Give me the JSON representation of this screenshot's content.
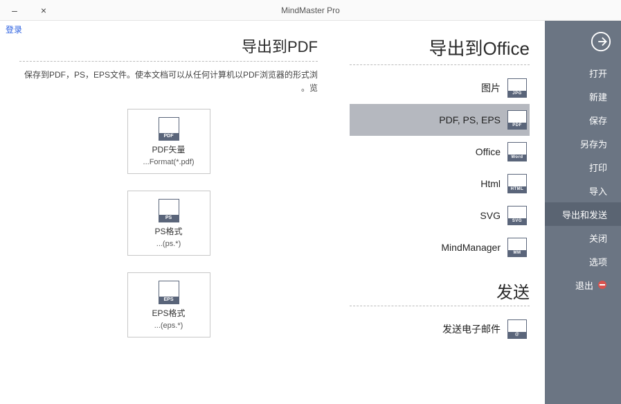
{
  "title": "MindMaster Pro",
  "login": "登录",
  "sidebar": {
    "items": [
      {
        "label": "打开"
      },
      {
        "label": "新建"
      },
      {
        "label": "保存"
      },
      {
        "label": "另存为"
      },
      {
        "label": "打印"
      },
      {
        "label": "导入"
      },
      {
        "label": "导出和发送",
        "selected": true
      },
      {
        "label": "关闭"
      },
      {
        "label": "选项"
      },
      {
        "label": "退出",
        "exit": true
      }
    ]
  },
  "middle": {
    "section1_title": "导出到Office",
    "categories": [
      {
        "tag": "JPG",
        "label": "图片"
      },
      {
        "tag": "PDF",
        "label": "PDF, PS, EPS",
        "selected": true
      },
      {
        "tag": "Word",
        "label": "Office"
      },
      {
        "tag": "HTML",
        "label": "Html"
      },
      {
        "tag": "SVG",
        "label": "SVG"
      },
      {
        "tag": "MM",
        "label": "MindManager"
      }
    ],
    "section2_title": "发送",
    "send_item": {
      "tag": "@",
      "label": "发送电子邮件"
    }
  },
  "detail": {
    "title": "导出到PDF",
    "desc": "保存到PDF，PS，EPS文件。使本文档可以从任何计算机以PDF浏览器的形式浏览。",
    "options": [
      {
        "tag": "PDF",
        "l1": "PDF矢量",
        "l2": "Format(*.pdf)..."
      },
      {
        "tag": "PS",
        "l1": "PS格式",
        "l2": "(*.ps)..."
      },
      {
        "tag": "EPS",
        "l1": "EPS格式",
        "l2": "(*.eps)..."
      }
    ]
  }
}
